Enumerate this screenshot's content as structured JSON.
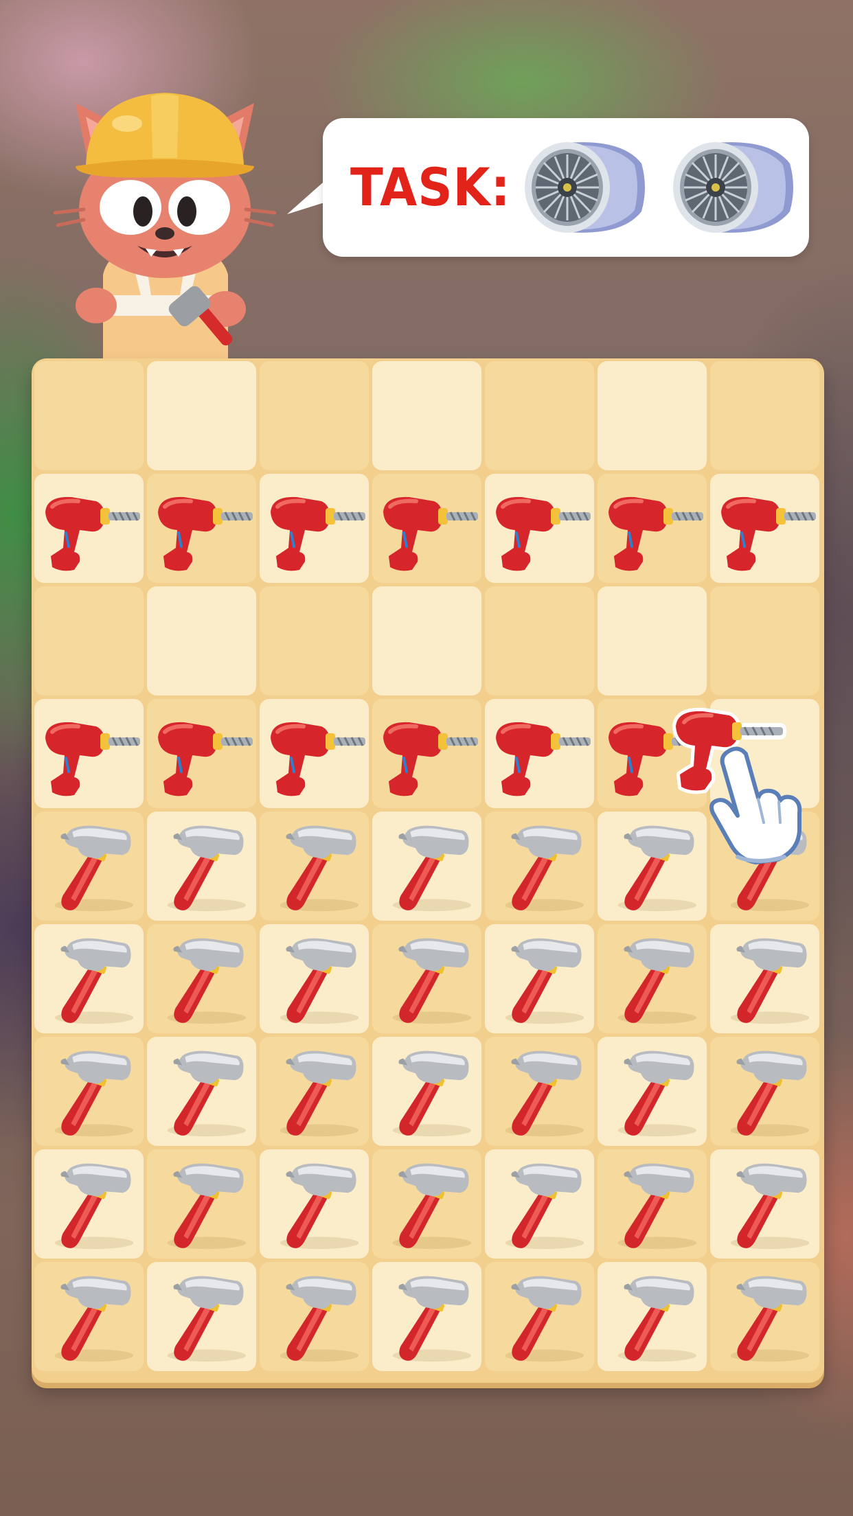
{
  "app": {
    "name": "tile-match-game-board"
  },
  "task": {
    "label": "TASK:",
    "label_color": "#e2231a",
    "targets": [
      {
        "icon": "jet-engine-icon"
      },
      {
        "icon": "jet-engine-icon"
      }
    ]
  },
  "mascot": {
    "icon": "cat-builder-mascot-icon"
  },
  "board": {
    "columns": 7,
    "rows": 9,
    "tile_colors": {
      "light": "#fbedca",
      "dark": "#f6d99c",
      "frame": "#f2cf8c"
    },
    "grid": [
      [
        "",
        "",
        "",
        "",
        "",
        "",
        ""
      ],
      [
        "drill",
        "drill",
        "drill",
        "drill",
        "drill",
        "drill",
        "drill"
      ],
      [
        "",
        "",
        "",
        "",
        "",
        "",
        ""
      ],
      [
        "drill",
        "drill",
        "drill",
        "drill",
        "drill",
        "drill",
        ""
      ],
      [
        "hammer",
        "hammer",
        "hammer",
        "hammer",
        "hammer",
        "hammer",
        "hammer"
      ],
      [
        "hammer",
        "hammer",
        "hammer",
        "hammer",
        "hammer",
        "hammer",
        "hammer"
      ],
      [
        "hammer",
        "hammer",
        "hammer",
        "hammer",
        "hammer",
        "hammer",
        "hammer"
      ],
      [
        "hammer",
        "hammer",
        "hammer",
        "hammer",
        "hammer",
        "hammer",
        "hammer"
      ],
      [
        "hammer",
        "hammer",
        "hammer",
        "hammer",
        "hammer",
        "hammer",
        "hammer"
      ]
    ],
    "dragged_item": {
      "icon": "drill-icon",
      "row": 4,
      "column": 7
    },
    "tutorial_hint": {
      "icon": "hand-pointer-icon"
    }
  }
}
